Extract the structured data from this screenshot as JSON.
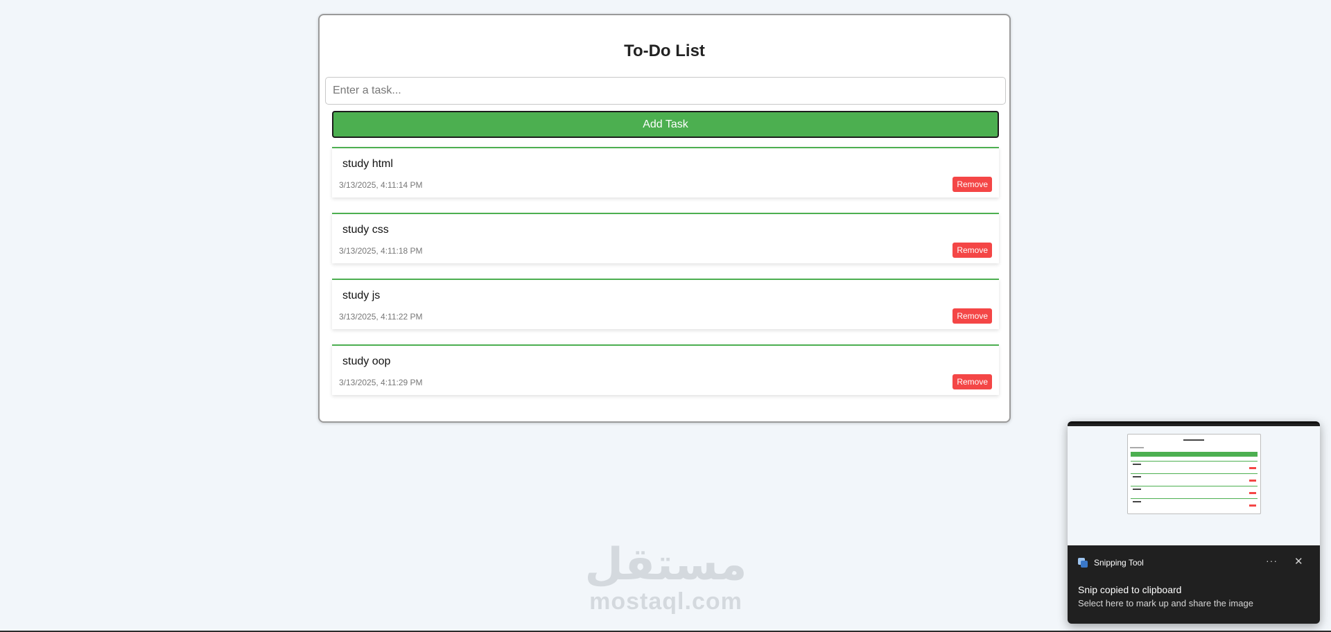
{
  "app": {
    "title": "To-Do List"
  },
  "input": {
    "placeholder": "Enter a task...",
    "value": ""
  },
  "add_button": {
    "label": "Add Task"
  },
  "tasks": [
    {
      "text": "study html",
      "date": "3/13/2025, 4:11:14 PM",
      "remove_label": "Remove"
    },
    {
      "text": "study css",
      "date": "3/13/2025, 4:11:18 PM",
      "remove_label": "Remove"
    },
    {
      "text": "study js",
      "date": "3/13/2025, 4:11:22 PM",
      "remove_label": "Remove"
    },
    {
      "text": "study oop",
      "date": "3/13/2025, 4:11:29 PM",
      "remove_label": "Remove"
    }
  ],
  "watermark": {
    "logo": "مستقل",
    "text": "mostaql.com"
  },
  "notification": {
    "app_name": "Snipping Tool",
    "title": "Snip copied to clipboard",
    "body": "Select here to mark up and share the image",
    "more_icon": "···",
    "close_icon": "✕"
  },
  "colors": {
    "accent_green": "#4caf50",
    "remove_red": "#f44646",
    "background": "#f2f6fa"
  }
}
